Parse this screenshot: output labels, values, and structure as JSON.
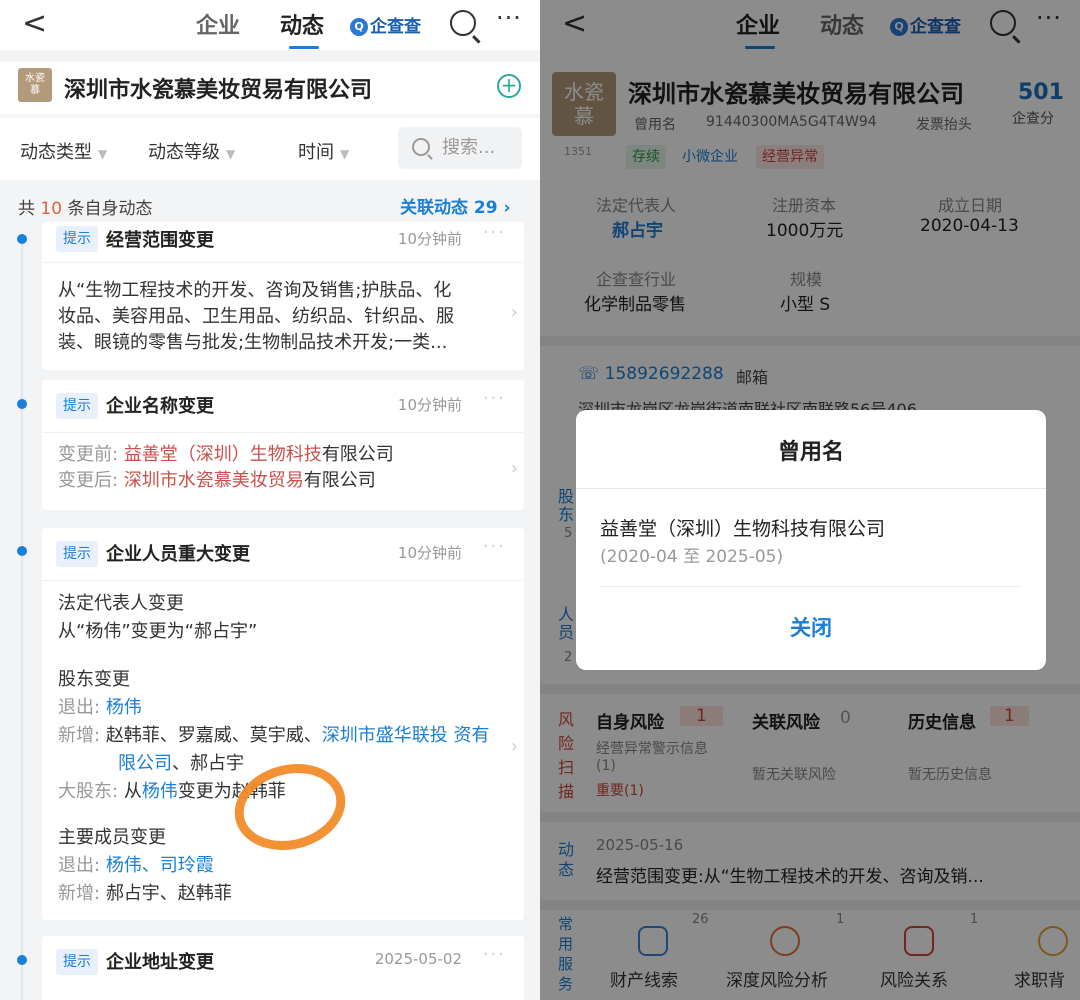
{
  "left": {
    "back": "<",
    "tabs": [
      "企业",
      "动态"
    ],
    "brand": "企查查",
    "brand_icon": "qcc-logo-icon",
    "more": "···",
    "company_logo": [
      "水瓷",
      "慕"
    ],
    "company_name": "深圳市水瓷慕美妆贸易有限公司",
    "plus": "+",
    "filters": [
      "动态类型",
      "动态等级",
      "时间"
    ],
    "search_placeholder": "搜索...",
    "count_prefix": "共",
    "count_num": "10",
    "count_suffix": "条自身动态",
    "related": "关联动态 29",
    "accent": "#1a7fd6",
    "cards": [
      {
        "tag": "提示",
        "title": "经营范围变更",
        "time": "10分钟前",
        "body": [
          "从“生物工程技术的开发、咨询及销售;护肤品、化",
          "妆品、美容用品、卫生用品、纺织品、针织品、服",
          "装、眼镜的零售与批发;生物制品技术开发;一类..."
        ]
      },
      {
        "tag": "提示",
        "title": "企业名称变更",
        "time": "10分钟前",
        "before_label": "变更前:",
        "before_hl": "益善堂（深圳）生物科技",
        "before_rest": "有限公司",
        "after_label": "变更后:",
        "after_hl": "深圳市水瓷慕美妆贸易",
        "after_rest": "有限公司"
      },
      {
        "tag": "提示",
        "title": "企业人员重大变更",
        "time": "10分钟前",
        "legal_title": "法定代表人变更",
        "legal_line": "从“杨伟”变更为“郝占宇”",
        "holder_title": "股东变更",
        "exit_label": "退出:",
        "exit_names": "杨伟",
        "add_label": "新增:",
        "add_names": "赵韩菲、罗嘉威、莫宇威、",
        "add_company_1": "深圳市盛华联投",
        "add_company_2": "资有限公司",
        "add_rest": "、郝占宇",
        "major_label": "大股东:",
        "major_from": "从",
        "major_old": "杨伟",
        "major_mid": "变更为",
        "major_new": "赵韩菲",
        "member_title": "主要成员变更",
        "m_exit_label": "退出:",
        "m_exit_names": "杨伟、司玲霞",
        "m_add_label": "新增:",
        "m_add_names": "郝占宇、赵韩菲"
      },
      {
        "tag": "提示",
        "title": "企业地址变更",
        "time": "2025-05-02"
      }
    ]
  },
  "right": {
    "tabs": [
      "企业",
      "动态"
    ],
    "brand": "企查查",
    "company_logo": [
      "水瓷",
      "慕"
    ],
    "company_name": "深圳市水瓷慕美妆贸易有限公司",
    "score": "501",
    "score_label": "企查分",
    "sub_1": "曾用名",
    "sub_2": "91440300MA5G4T4W94",
    "sub_3": "发票抬头",
    "views": "1351",
    "pills": [
      "存续",
      "小微企业",
      "经营异常"
    ],
    "legal_rep_label": "法定代表人",
    "legal_rep": "郝占宇",
    "capital_label": "注册资本",
    "capital": "1000万元",
    "founded_label": "成立日期",
    "founded": "2020-04-13",
    "industry_label": "企查查行业",
    "industry": "化学制品零售",
    "scale_label": "规模",
    "scale": "小型 S",
    "phone": "15892692288",
    "email_label": "邮箱",
    "address": "深圳市龙岗区龙岗街道南联社区南联路56号406",
    "side_1": "股东",
    "side_1n": "5",
    "side_2": "人员",
    "side_2n": "2",
    "risk_side": "风险扫描",
    "risk_self": "自身风险",
    "risk_self_n": "1",
    "risk_self_d1": "经营异常警示信息",
    "risk_self_d2": "(1)",
    "risk_self_d3": "重要(1)",
    "risk_rel": "关联风险",
    "risk_rel_n": "0",
    "risk_rel_d": "暂无关联风险",
    "risk_hist": "历史信息",
    "risk_hist_n": "1",
    "risk_hist_d": "暂无历史信息",
    "dyn_side": "动态",
    "dyn_date": "2025-05-16",
    "dyn_text": "经营范围变更:从“生物工程技术的开发、咨询及销...",
    "svc_side": "常用服务",
    "tools": [
      "财产线索",
      "深度风险分析",
      "风险关系",
      "求职背"
    ],
    "tool_badges": [
      "26",
      "1",
      "1"
    ],
    "modal": {
      "title": "曾用名",
      "name": "益善堂（深圳）生物科技有限公司",
      "range": "(2020-04 至 2025-05)",
      "close": "关闭"
    }
  }
}
